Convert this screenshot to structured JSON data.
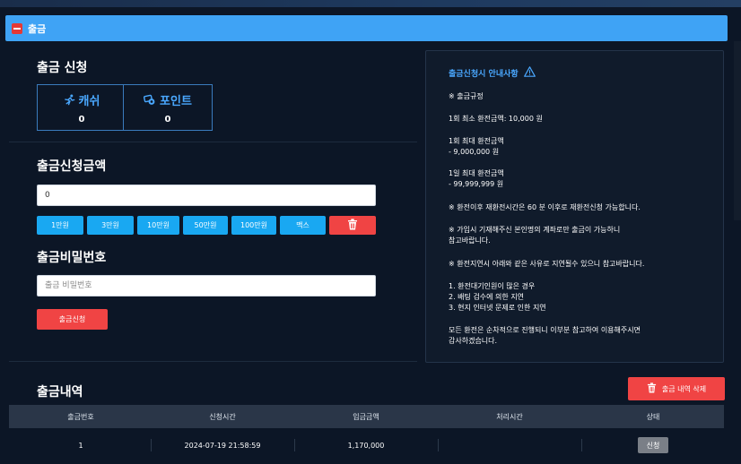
{
  "header": {
    "title": "출금"
  },
  "withdraw_request": {
    "title": "출금 신청",
    "cash": {
      "label": "캐쉬",
      "value": "0"
    },
    "point": {
      "label": "포인트",
      "value": "0"
    }
  },
  "amount": {
    "title": "출금신청금액",
    "input_value": "0",
    "quick_buttons": [
      "1만원",
      "3만원",
      "10만원",
      "50만원",
      "100만원",
      "맥스"
    ]
  },
  "password": {
    "title": "출금비밀번호",
    "placeholder": "출금 비밀번호",
    "submit_label": "출금신청"
  },
  "notice": {
    "title": "출금신청시 안내사항",
    "lines": [
      "※ 출금규정",
      "1회 최소 환전금액: 10,000 원",
      "1회 최대 환전금액",
      "- 9,000,000 원",
      "1일 최대 환전금액",
      "- 99,999,999 원",
      "※ 환전이후 재환전시간은 60 분 이후로 재환전신청 가능합니다.",
      "※ 가입시 기재해주신 본인명의 계좌로만 출금이 가능하니",
      "참고바랍니다.",
      "※ 환전지연시 아래와 같은 사유로 지연될수 있으니 참고바랍니다.",
      "1. 환전대기인원이 많은 경우",
      "2. 배팅 검수에 의한 지연",
      "3. 현지 인터넷 문제로 인한 지연",
      "모든 환전은 순차적으로 진행되니 이부분 참고하여 이용해주시면",
      "감사하겠습니다."
    ]
  },
  "history": {
    "title": "출금내역",
    "delete_label": "출금 내역 삭제",
    "columns": [
      "출금번호",
      "신청시간",
      "입금금액",
      "처리시간",
      "상태"
    ],
    "rows": [
      {
        "no": "1",
        "requested_at": "2024-07-19 21:58:59",
        "amount": "1,170,000",
        "processed_at": "",
        "status": "신청"
      }
    ]
  },
  "colors": {
    "accent_blue": "#3fa3f5",
    "button_blue": "#19a8f2",
    "danger_red": "#f04444",
    "background": "#0c1626"
  }
}
